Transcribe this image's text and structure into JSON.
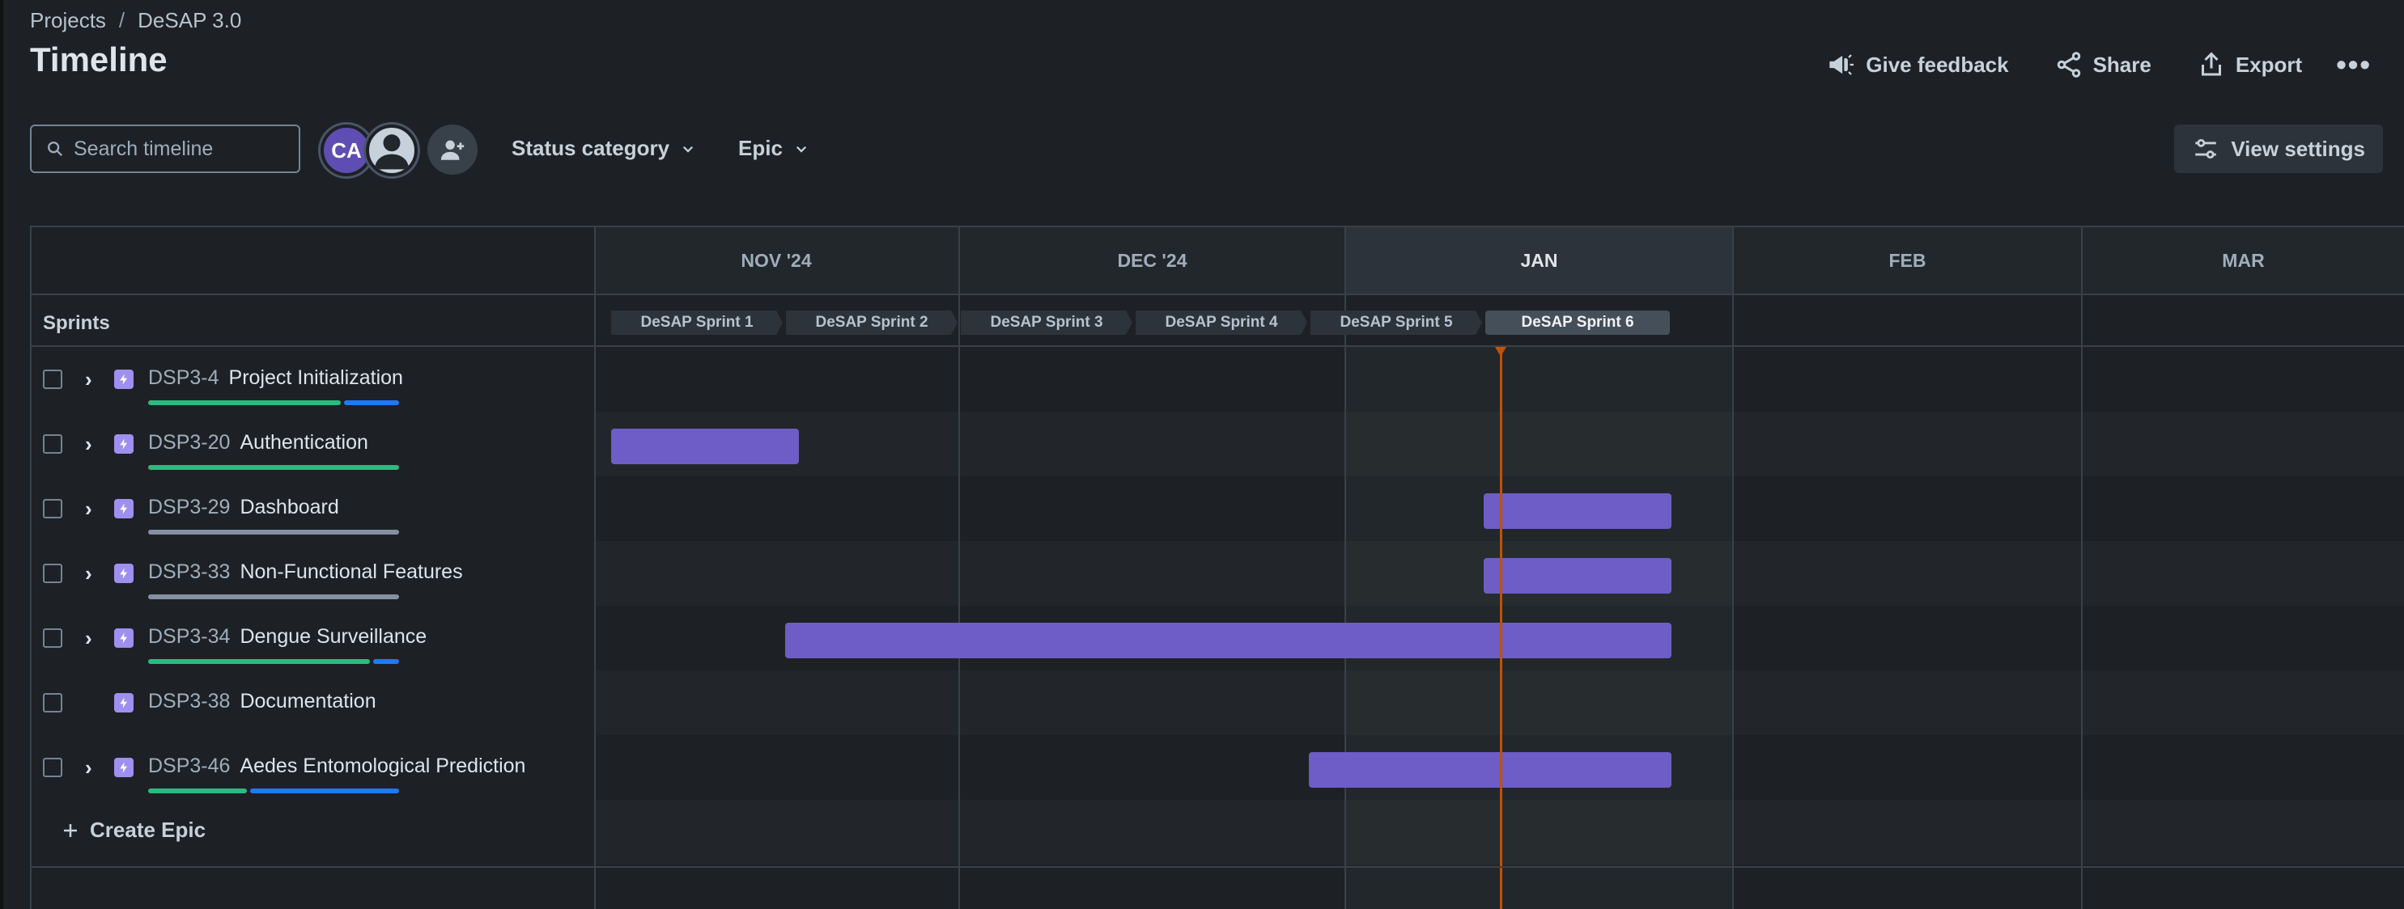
{
  "breadcrumb": {
    "projects": "Projects",
    "separator": "/",
    "project": "DeSAP 3.0"
  },
  "page_title": "Timeline",
  "actions": {
    "feedback": "Give feedback",
    "share": "Share",
    "export": "Export",
    "more": "•••"
  },
  "toolbar": {
    "search_placeholder": "Search timeline",
    "avatar_initials": "CA",
    "status_filter": "Status category",
    "epic_filter": "Epic",
    "view_settings": "View settings"
  },
  "months": [
    {
      "label": "NOV '24"
    },
    {
      "label": "DEC '24"
    },
    {
      "label": "JAN"
    },
    {
      "label": "FEB"
    },
    {
      "label": "MAR"
    }
  ],
  "sprints_label": "Sprints",
  "sprints": [
    "DeSAP Sprint 1",
    "DeSAP Sprint 2",
    "DeSAP Sprint 3",
    "DeSAP Sprint 4",
    "DeSAP Sprint 5",
    "DeSAP Sprint 6"
  ],
  "active_sprint": "DeSAP Sprint 6",
  "epics": [
    {
      "key": "DSP3-4",
      "title": "Project Initialization",
      "expandable": true
    },
    {
      "key": "DSP3-20",
      "title": "Authentication",
      "expandable": true
    },
    {
      "key": "DSP3-29",
      "title": "Dashboard",
      "expandable": true
    },
    {
      "key": "DSP3-33",
      "title": "Non-Functional Features",
      "expandable": true
    },
    {
      "key": "DSP3-34",
      "title": "Dengue Surveillance",
      "expandable": true
    },
    {
      "key": "DSP3-38",
      "title": "Documentation",
      "expandable": false
    },
    {
      "key": "DSP3-46",
      "title": "Aedes Entomological Prediction",
      "expandable": true
    }
  ],
  "create_epic": "Create Epic",
  "colors": {
    "bar": "#6e5dc6",
    "today": "#c25100",
    "done": "#2abb7f",
    "in_progress": "#1d7afc",
    "todo": "#8590a2"
  }
}
